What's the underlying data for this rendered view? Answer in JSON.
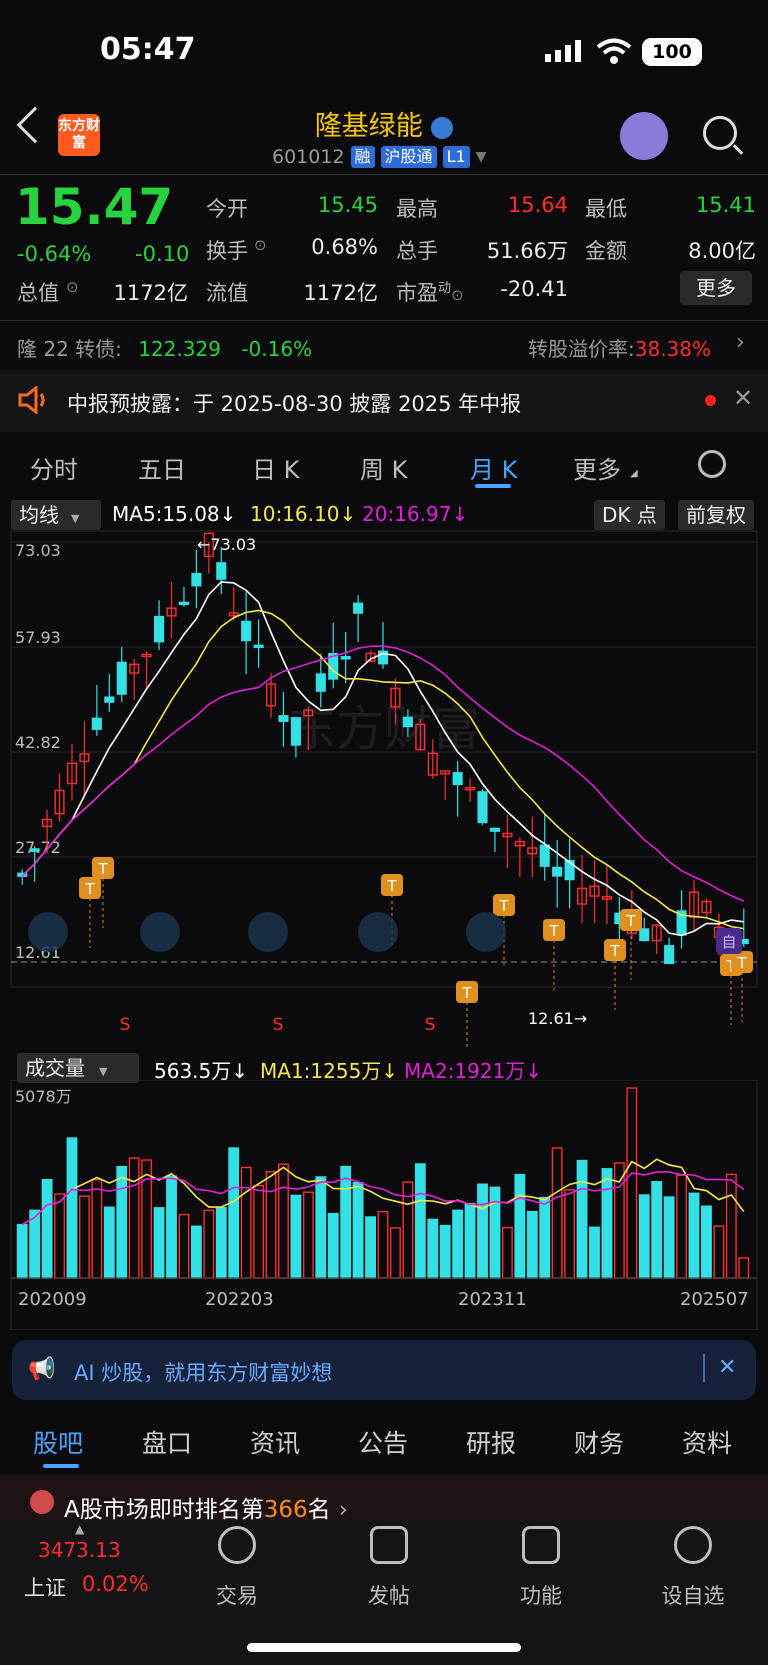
{
  "status": {
    "time": "05:47",
    "battery": "100"
  },
  "header": {
    "logo_text": "东方财富",
    "stock_name": "隆基绿能",
    "stock_code": "601012",
    "tags": [
      "融",
      "沪股通",
      "L1"
    ]
  },
  "quote": {
    "price": "15.47",
    "change_pct": "-0.64%",
    "change": "-0.10",
    "fields": {
      "open_label": "今开",
      "open": "15.45",
      "high_label": "最高",
      "high": "15.64",
      "low_label": "最低",
      "low": "15.41",
      "turnover_label": "换手",
      "turnover": "0.68%",
      "volume_label": "总手",
      "volume": "51.66万",
      "amount_label": "金额",
      "amount": "8.00亿",
      "mktcap_label": "总值",
      "mktcap": "1172亿",
      "float_label": "流值",
      "float": "1172亿",
      "pe_label": "市盈",
      "pe_sup": "动",
      "pe": "-20.41"
    },
    "more_button": "更多"
  },
  "bond": {
    "label": "隆 22 转债:",
    "price": "122.329",
    "change": "-0.16%",
    "premium_label": "转股溢价率:",
    "premium": "38.38%"
  },
  "notice": {
    "text": "中报预披露：于 2025-08-30 披露 2025 年中报"
  },
  "tabs": [
    "分时",
    "五日",
    "日 K",
    "周 K",
    "月 K",
    "更多"
  ],
  "active_tab": "月 K",
  "chart_toolbar": {
    "ma_select": "均线",
    "ma5": "MA5:15.08↓",
    "ma10": "10:16.10↓",
    "ma20": "20:16.97↓",
    "dk_button": "DK 点",
    "adjust_button": "前复权"
  },
  "vol_toolbar": {
    "select": "成交量",
    "vol": "563.5万↓",
    "ma1": "MA1:1255万↓",
    "ma2": "MA2:1921万↓"
  },
  "chart_data": {
    "type": "candlestick",
    "y_ticks": [
      "73.03",
      "57.93",
      "42.82",
      "27.72",
      "12.61"
    ],
    "ylim": [
      12.61,
      73.03
    ],
    "high_annotation": "←73.03",
    "low_annotation": "12.61→",
    "vol_max_label": "5078万",
    "x_ticks": [
      "202009",
      "202203",
      "202311",
      "202507"
    ],
    "colors": {
      "up": "#ff2d2d",
      "down": "#32e0e6",
      "ma5": "#ffffff",
      "ma10": "#f5e84a",
      "ma20": "#e020d8"
    },
    "watermark": "东方财富",
    "marker_labels": [
      "T",
      "S",
      "自"
    ]
  },
  "ai_banner": {
    "text": "AI 炒股，就用东方财富妙想"
  },
  "bottom_tabs": [
    "股吧",
    "盘口",
    "资讯",
    "公告",
    "研报",
    "财务",
    "资料"
  ],
  "rank": {
    "prefix": "A股市场即时排名第",
    "rank": "366",
    "suffix": "名"
  },
  "nav": {
    "index_value": "3473.13",
    "index_name": "上证",
    "index_change": "0.02%",
    "items": [
      "交易",
      "发帖",
      "功能",
      "设自选"
    ]
  }
}
